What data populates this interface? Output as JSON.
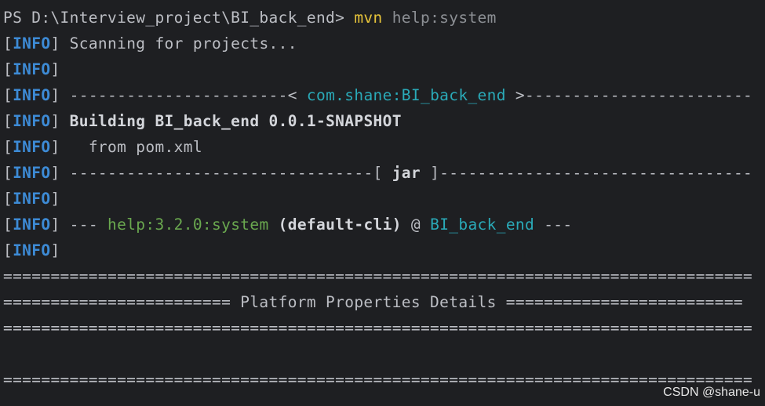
{
  "prompt": {
    "path": "PS D:\\Interview_project\\BI_back_end>",
    "command": "mvn",
    "args": "help:system"
  },
  "info_tag": "INFO",
  "lines": {
    "l1_text": "Scanning for projects...",
    "l3_left": "-----------------------< ",
    "l3_artifact": "com.shane:BI_back_end",
    "l3_right": " >------------------------",
    "l4_text": "Building BI_back_end 0.0.1-SNAPSHOT",
    "l5_text": "  from pom.xml",
    "l6_left": "--------------------------------[ ",
    "l6_packaging": "jar",
    "l6_right": " ]---------------------------------",
    "l8_prefix": "--- ",
    "l8_plugin": "help:3.2.0:system",
    "l8_exec": "(default-cli)",
    "l8_at": "@",
    "l8_project": "BI_back_end",
    "l8_suffix": "---"
  },
  "banner": {
    "full": "===============================================================================",
    "title_left": "======================== ",
    "title": "Platform Properties Details",
    "title_right": " ========================="
  },
  "watermark": "CSDN @shane-u"
}
